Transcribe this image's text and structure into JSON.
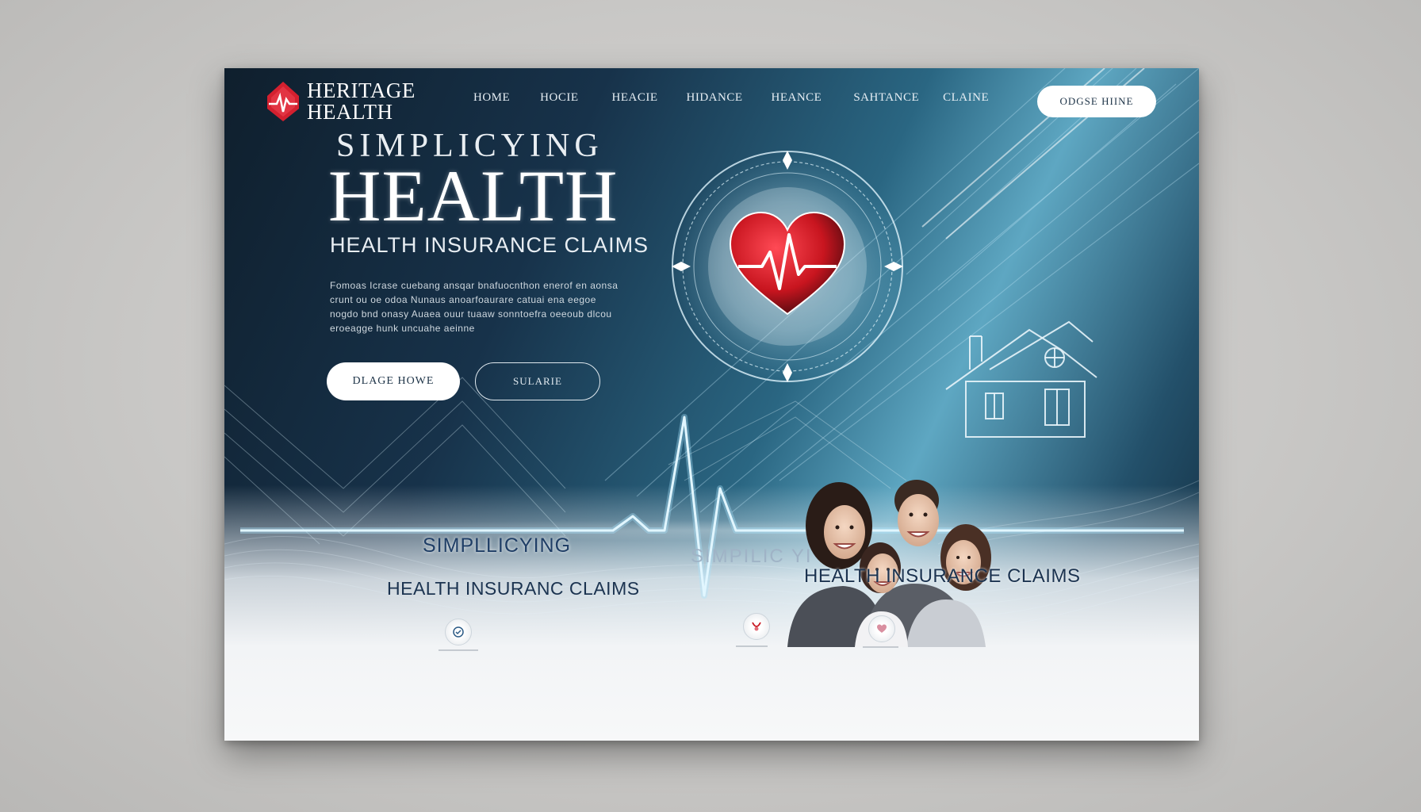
{
  "brand": {
    "name_line1": "HERITAGE",
    "name_line2": "HEALTH",
    "accent_color": "#d3202f"
  },
  "nav": {
    "items": [
      "HOME",
      "HOCIE",
      "HEACIE",
      "HIDANCE",
      "HEANCE",
      "SAHTANCE",
      "CLAINE"
    ],
    "cta_label": "ODGSE HIINE"
  },
  "hero": {
    "kicker": "SIMPLICYING",
    "title": "HEALTH",
    "subtitle": "HEALTH INSURANCE CLAIMS",
    "body": "Fomoas Icrase cuebang ansqar bnafuocnthon enerof en aonsa crunt ou oe odoa Nunaus anoarfoaurare catuai ena eegoe nogdo bnd onasy Auaea ouur tuaaw sonntoefra oeeoub dlcou eroeagge hunk uncuahe aeinne",
    "primary_button": "DLAGE HOWE",
    "secondary_button": "SULARIE"
  },
  "lower": {
    "kicker_left": "SIMPLLICYING",
    "kicker_faded": "SIMPILIC YI",
    "claims_left": "HEALTH INSURANC CLAIMS",
    "claims_right": "HEALTH INSURANCE CLAIMS"
  },
  "icons": [
    "heart-pulse-icon",
    "emblem-heart-icon",
    "house-icon",
    "shield-icon",
    "stethoscope-icon",
    "care-icon"
  ],
  "colors": {
    "navy": "#0f1f2d",
    "teal": "#5ea7c2",
    "heart_red": "#c8151f"
  }
}
